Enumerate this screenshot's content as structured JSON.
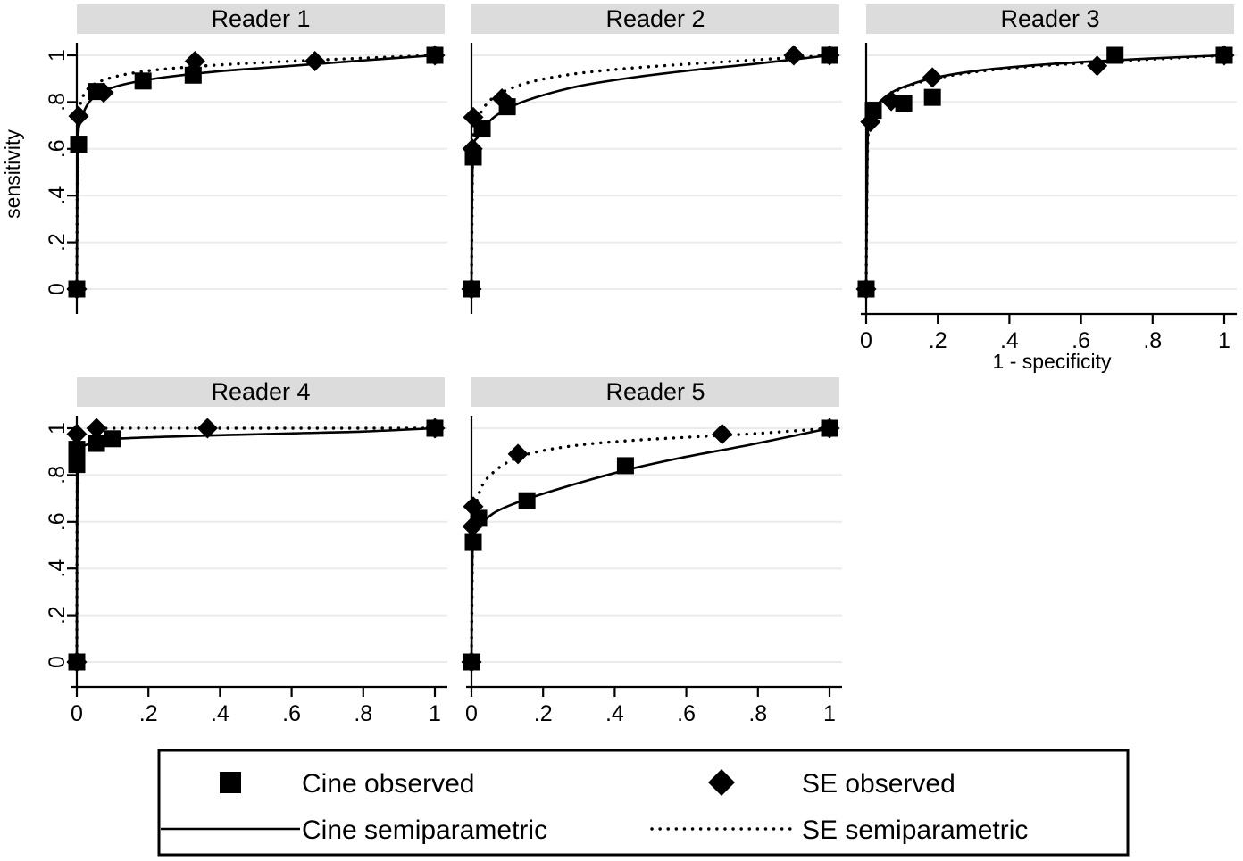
{
  "figure": {
    "axis_titles": {
      "x": "1 - specificity",
      "y": "sensitivity"
    },
    "x_ticks": [
      "0",
      ".2",
      ".4",
      ".6",
      ".8",
      "1"
    ],
    "y_ticks": [
      "0",
      ".2",
      ".4",
      ".6",
      ".8",
      "1"
    ],
    "panel_title_bg": "#dcdcdc",
    "line_color": "#000000",
    "grid_color": "#ebebeb"
  },
  "legend": {
    "entries": [
      {
        "key": "cine-observed",
        "label": "Cine observed",
        "glyph": "square-marker"
      },
      {
        "key": "se-observed",
        "label": "SE observed",
        "glyph": "diamond-marker"
      },
      {
        "key": "cine-semiparametric",
        "label": "Cine semiparametric",
        "glyph": "solid-line"
      },
      {
        "key": "se-semiparametric",
        "label": "SE semiparametric",
        "glyph": "dotted-line"
      }
    ]
  },
  "panels": [
    {
      "id": "reader-1",
      "title": "Reader 1"
    },
    {
      "id": "reader-2",
      "title": "Reader 2"
    },
    {
      "id": "reader-3",
      "title": "Reader 3"
    },
    {
      "id": "reader-4",
      "title": "Reader 4"
    },
    {
      "id": "reader-5",
      "title": "Reader 5"
    }
  ],
  "chart_data": {
    "type": "line",
    "title": "",
    "xlabel": "1 - specificity",
    "ylabel": "sensitivity",
    "xlim": [
      0,
      1
    ],
    "ylim": [
      0,
      1
    ],
    "xticks": [
      0,
      0.2,
      0.4,
      0.6,
      0.8,
      1
    ],
    "yticks": [
      0,
      0.2,
      0.4,
      0.6,
      0.8,
      1
    ],
    "grid": true,
    "legend_position": "bottom",
    "panel_layout": "2 rows x 3 columns",
    "panels": [
      {
        "title": "Reader 1",
        "series": [
          {
            "name": "Cine observed",
            "type": "scatter",
            "marker": "square",
            "points": [
              {
                "x": 0.0,
                "y": 0.0
              },
              {
                "x": 0.005,
                "y": 0.62
              },
              {
                "x": 0.055,
                "y": 0.845
              },
              {
                "x": 0.185,
                "y": 0.89
              },
              {
                "x": 0.325,
                "y": 0.915
              },
              {
                "x": 1.0,
                "y": 1.0
              }
            ]
          },
          {
            "name": "SE observed",
            "type": "scatter",
            "marker": "diamond",
            "points": [
              {
                "x": 0.0,
                "y": 0.0
              },
              {
                "x": 0.005,
                "y": 0.74
              },
              {
                "x": 0.075,
                "y": 0.84
              },
              {
                "x": 0.33,
                "y": 0.975
              },
              {
                "x": 0.665,
                "y": 0.975
              },
              {
                "x": 1.0,
                "y": 1.0
              }
            ]
          },
          {
            "name": "Cine semiparametric",
            "type": "line",
            "style": "solid",
            "points": [
              {
                "x": 0.0,
                "y": 0.0
              },
              {
                "x": 0.003,
                "y": 0.61
              },
              {
                "x": 0.012,
                "y": 0.72
              },
              {
                "x": 0.03,
                "y": 0.79
              },
              {
                "x": 0.06,
                "y": 0.835
              },
              {
                "x": 0.1,
                "y": 0.862
              },
              {
                "x": 0.16,
                "y": 0.885
              },
              {
                "x": 0.25,
                "y": 0.907
              },
              {
                "x": 0.4,
                "y": 0.932
              },
              {
                "x": 0.6,
                "y": 0.955
              },
              {
                "x": 0.8,
                "y": 0.978
              },
              {
                "x": 1.0,
                "y": 1.0
              }
            ]
          },
          {
            "name": "SE semiparametric",
            "type": "line",
            "style": "dotted",
            "points": [
              {
                "x": 0.0,
                "y": 0.0
              },
              {
                "x": 0.003,
                "y": 0.7
              },
              {
                "x": 0.012,
                "y": 0.8
              },
              {
                "x": 0.03,
                "y": 0.855
              },
              {
                "x": 0.06,
                "y": 0.885
              },
              {
                "x": 0.1,
                "y": 0.906
              },
              {
                "x": 0.16,
                "y": 0.925
              },
              {
                "x": 0.25,
                "y": 0.942
              },
              {
                "x": 0.4,
                "y": 0.959
              },
              {
                "x": 0.6,
                "y": 0.975
              },
              {
                "x": 0.8,
                "y": 0.988
              },
              {
                "x": 1.0,
                "y": 1.0
              }
            ]
          }
        ]
      },
      {
        "title": "Reader 2",
        "series": [
          {
            "name": "Cine observed",
            "type": "scatter",
            "marker": "square",
            "points": [
              {
                "x": 0.0,
                "y": 0.0
              },
              {
                "x": 0.005,
                "y": 0.565
              },
              {
                "x": 0.03,
                "y": 0.685
              },
              {
                "x": 0.1,
                "y": 0.78
              },
              {
                "x": 1.0,
                "y": 1.0
              }
            ]
          },
          {
            "name": "SE observed",
            "type": "scatter",
            "marker": "diamond",
            "points": [
              {
                "x": 0.0,
                "y": 0.0
              },
              {
                "x": 0.003,
                "y": 0.6
              },
              {
                "x": 0.005,
                "y": 0.735
              },
              {
                "x": 0.085,
                "y": 0.815
              },
              {
                "x": 0.9,
                "y": 1.0
              },
              {
                "x": 1.0,
                "y": 1.0
              }
            ]
          },
          {
            "name": "Cine semiparametric",
            "type": "line",
            "style": "solid",
            "points": [
              {
                "x": 0.0,
                "y": 0.0
              },
              {
                "x": 0.004,
                "y": 0.56
              },
              {
                "x": 0.02,
                "y": 0.655
              },
              {
                "x": 0.05,
                "y": 0.718
              },
              {
                "x": 0.1,
                "y": 0.772
              },
              {
                "x": 0.18,
                "y": 0.82
              },
              {
                "x": 0.3,
                "y": 0.868
              },
              {
                "x": 0.45,
                "y": 0.905
              },
              {
                "x": 0.62,
                "y": 0.937
              },
              {
                "x": 0.8,
                "y": 0.965
              },
              {
                "x": 1.0,
                "y": 1.0
              }
            ]
          },
          {
            "name": "SE semiparametric",
            "type": "line",
            "style": "dotted",
            "points": [
              {
                "x": 0.0,
                "y": 0.0
              },
              {
                "x": 0.004,
                "y": 0.6
              },
              {
                "x": 0.012,
                "y": 0.69
              },
              {
                "x": 0.03,
                "y": 0.765
              },
              {
                "x": 0.06,
                "y": 0.818
              },
              {
                "x": 0.1,
                "y": 0.852
              },
              {
                "x": 0.17,
                "y": 0.888
              },
              {
                "x": 0.28,
                "y": 0.919
              },
              {
                "x": 0.42,
                "y": 0.942
              },
              {
                "x": 0.6,
                "y": 0.962
              },
              {
                "x": 0.8,
                "y": 0.981
              },
              {
                "x": 1.0,
                "y": 1.0
              }
            ]
          }
        ]
      },
      {
        "title": "Reader 3",
        "series": [
          {
            "name": "Cine observed",
            "type": "scatter",
            "marker": "square",
            "points": [
              {
                "x": 0.0,
                "y": 0.0
              },
              {
                "x": 0.02,
                "y": 0.765
              },
              {
                "x": 0.105,
                "y": 0.795
              },
              {
                "x": 0.185,
                "y": 0.82
              },
              {
                "x": 0.695,
                "y": 1.0
              },
              {
                "x": 1.0,
                "y": 1.0
              }
            ]
          },
          {
            "name": "SE observed",
            "type": "scatter",
            "marker": "diamond",
            "points": [
              {
                "x": 0.0,
                "y": 0.0
              },
              {
                "x": 0.012,
                "y": 0.715
              },
              {
                "x": 0.07,
                "y": 0.805
              },
              {
                "x": 0.185,
                "y": 0.905
              },
              {
                "x": 0.645,
                "y": 0.955
              },
              {
                "x": 1.0,
                "y": 1.0
              }
            ]
          },
          {
            "name": "Cine semiparametric",
            "type": "line",
            "style": "solid",
            "points": [
              {
                "x": 0.0,
                "y": 0.0
              },
              {
                "x": 0.004,
                "y": 0.63
              },
              {
                "x": 0.012,
                "y": 0.715
              },
              {
                "x": 0.03,
                "y": 0.785
              },
              {
                "x": 0.06,
                "y": 0.83
              },
              {
                "x": 0.1,
                "y": 0.862
              },
              {
                "x": 0.18,
                "y": 0.9
              },
              {
                "x": 0.3,
                "y": 0.932
              },
              {
                "x": 0.45,
                "y": 0.955
              },
              {
                "x": 0.62,
                "y": 0.973
              },
              {
                "x": 0.8,
                "y": 0.987
              },
              {
                "x": 1.0,
                "y": 1.0
              }
            ]
          },
          {
            "name": "SE semiparametric",
            "type": "line",
            "style": "dotted",
            "points": [
              {
                "x": 0.0,
                "y": 0.0
              },
              {
                "x": 0.004,
                "y": 0.6
              },
              {
                "x": 0.012,
                "y": 0.705
              },
              {
                "x": 0.03,
                "y": 0.78
              },
              {
                "x": 0.06,
                "y": 0.827
              },
              {
                "x": 0.1,
                "y": 0.858
              },
              {
                "x": 0.18,
                "y": 0.897
              },
              {
                "x": 0.3,
                "y": 0.928
              },
              {
                "x": 0.45,
                "y": 0.951
              },
              {
                "x": 0.62,
                "y": 0.968
              },
              {
                "x": 0.8,
                "y": 0.983
              },
              {
                "x": 1.0,
                "y": 1.0
              }
            ]
          }
        ]
      },
      {
        "title": "Reader 4",
        "series": [
          {
            "name": "Cine observed",
            "type": "scatter",
            "marker": "square",
            "points": [
              {
                "x": 0.0,
                "y": 0.0
              },
              {
                "x": 0.0,
                "y": 0.845
              },
              {
                "x": 0.0,
                "y": 0.91
              },
              {
                "x": 0.055,
                "y": 0.935
              },
              {
                "x": 0.1,
                "y": 0.955
              },
              {
                "x": 1.0,
                "y": 1.0
              }
            ]
          },
          {
            "name": "SE observed",
            "type": "scatter",
            "marker": "diamond",
            "points": [
              {
                "x": 0.0,
                "y": 0.0
              },
              {
                "x": 0.0,
                "y": 0.975
              },
              {
                "x": 0.055,
                "y": 1.0
              },
              {
                "x": 0.365,
                "y": 1.0
              },
              {
                "x": 1.0,
                "y": 1.0
              }
            ]
          },
          {
            "name": "Cine semiparametric",
            "type": "line",
            "style": "solid",
            "points": [
              {
                "x": 0.0,
                "y": 0.0
              },
              {
                "x": 0.002,
                "y": 0.85
              },
              {
                "x": 0.01,
                "y": 0.912
              },
              {
                "x": 0.04,
                "y": 0.935
              },
              {
                "x": 0.1,
                "y": 0.954
              },
              {
                "x": 0.3,
                "y": 0.966
              },
              {
                "x": 0.6,
                "y": 0.978
              },
              {
                "x": 0.8,
                "y": 0.986
              },
              {
                "x": 1.0,
                "y": 1.0
              }
            ]
          },
          {
            "name": "SE semiparametric",
            "type": "line",
            "style": "dotted",
            "points": [
              {
                "x": 0.0,
                "y": 0.0
              },
              {
                "x": 0.002,
                "y": 0.94
              },
              {
                "x": 0.01,
                "y": 0.978
              },
              {
                "x": 0.04,
                "y": 0.995
              },
              {
                "x": 0.1,
                "y": 1.0
              },
              {
                "x": 0.4,
                "y": 1.0
              },
              {
                "x": 0.7,
                "y": 1.0
              },
              {
                "x": 1.0,
                "y": 1.0
              }
            ]
          }
        ]
      },
      {
        "title": "Reader 5",
        "series": [
          {
            "name": "Cine observed",
            "type": "scatter",
            "marker": "square",
            "points": [
              {
                "x": 0.0,
                "y": 0.0
              },
              {
                "x": 0.005,
                "y": 0.515
              },
              {
                "x": 0.02,
                "y": 0.615
              },
              {
                "x": 0.155,
                "y": 0.69
              },
              {
                "x": 0.43,
                "y": 0.84
              },
              {
                "x": 1.0,
                "y": 1.0
              }
            ]
          },
          {
            "name": "SE observed",
            "type": "scatter",
            "marker": "diamond",
            "points": [
              {
                "x": 0.0,
                "y": 0.0
              },
              {
                "x": 0.003,
                "y": 0.58
              },
              {
                "x": 0.005,
                "y": 0.665
              },
              {
                "x": 0.13,
                "y": 0.89
              },
              {
                "x": 0.7,
                "y": 0.975
              },
              {
                "x": 1.0,
                "y": 1.0
              }
            ]
          },
          {
            "name": "Cine semiparametric",
            "type": "line",
            "style": "solid",
            "points": [
              {
                "x": 0.0,
                "y": 0.0
              },
              {
                "x": 0.004,
                "y": 0.51
              },
              {
                "x": 0.02,
                "y": 0.575
              },
              {
                "x": 0.06,
                "y": 0.635
              },
              {
                "x": 0.12,
                "y": 0.678
              },
              {
                "x": 0.2,
                "y": 0.72
              },
              {
                "x": 0.32,
                "y": 0.775
              },
              {
                "x": 0.45,
                "y": 0.828
              },
              {
                "x": 0.6,
                "y": 0.878
              },
              {
                "x": 0.78,
                "y": 0.93
              },
              {
                "x": 1.0,
                "y": 1.0
              }
            ]
          },
          {
            "name": "SE semiparametric",
            "type": "line",
            "style": "dotted",
            "points": [
              {
                "x": 0.0,
                "y": 0.0
              },
              {
                "x": 0.004,
                "y": 0.575
              },
              {
                "x": 0.012,
                "y": 0.67
              },
              {
                "x": 0.03,
                "y": 0.755
              },
              {
                "x": 0.06,
                "y": 0.81
              },
              {
                "x": 0.11,
                "y": 0.862
              },
              {
                "x": 0.18,
                "y": 0.898
              },
              {
                "x": 0.3,
                "y": 0.928
              },
              {
                "x": 0.45,
                "y": 0.948
              },
              {
                "x": 0.62,
                "y": 0.963
              },
              {
                "x": 0.8,
                "y": 0.978
              },
              {
                "x": 1.0,
                "y": 1.0
              }
            ]
          }
        ]
      }
    ]
  }
}
